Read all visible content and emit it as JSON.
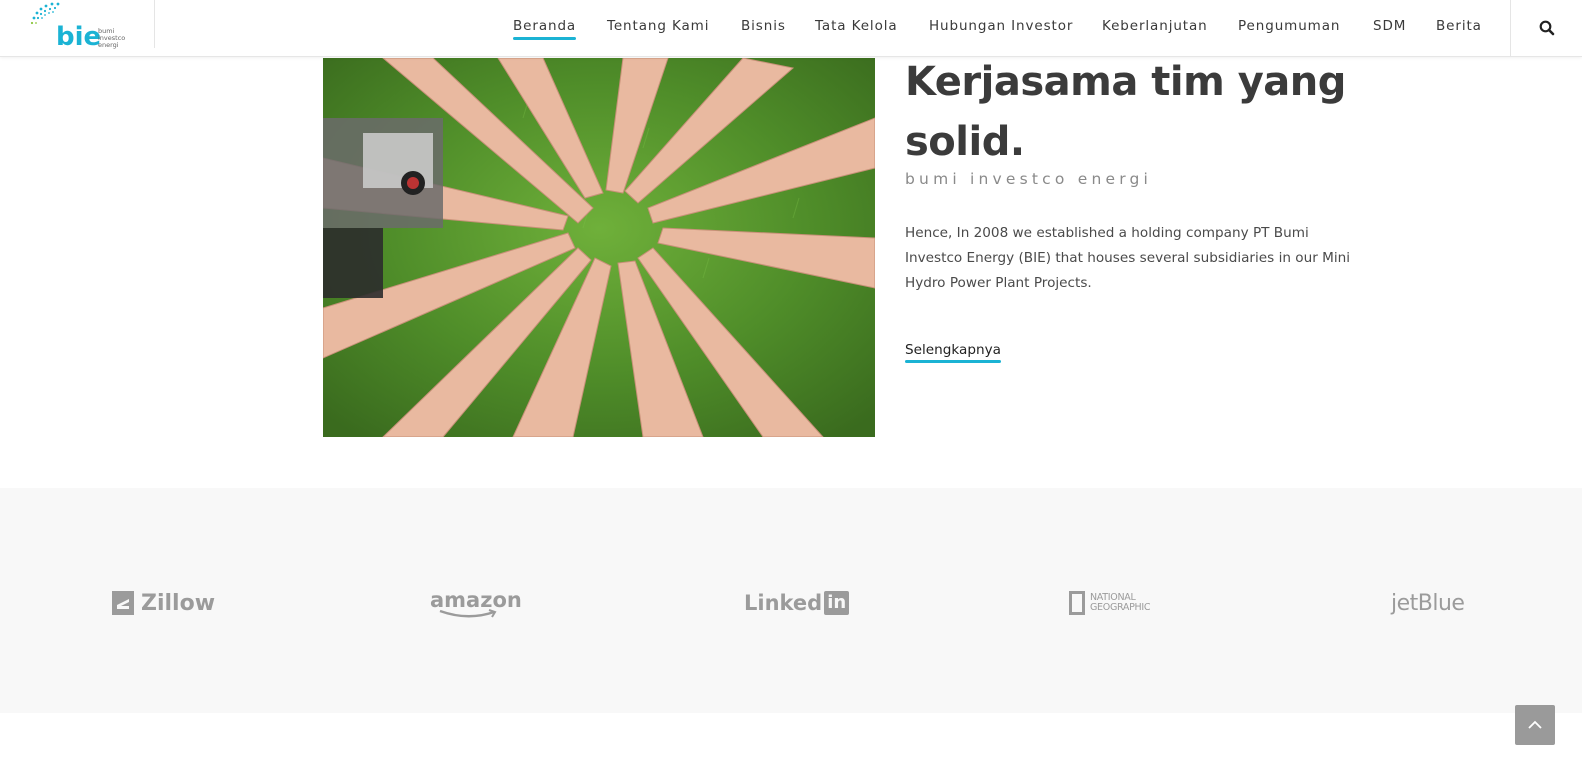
{
  "header": {
    "logo": {
      "mark": "bie",
      "tagline_lines": [
        "bumi",
        "investco",
        "energi"
      ]
    },
    "nav": [
      {
        "label": "Beranda",
        "active": true
      },
      {
        "label": "Tentang Kami",
        "active": false
      },
      {
        "label": "Bisnis",
        "active": false
      },
      {
        "label": "Tata Kelola",
        "active": false
      },
      {
        "label": "Hubungan Investor",
        "active": false
      },
      {
        "label": "Keberlanjutan",
        "active": false
      },
      {
        "label": "Pengumuman",
        "active": false
      },
      {
        "label": "SDM",
        "active": false
      },
      {
        "label": "Berita",
        "active": false
      }
    ],
    "search_icon": "search-icon"
  },
  "hero": {
    "image_icon": "hands-circle-photo",
    "headline": "Kerjasama tim yang solid.",
    "subline": "bumi investco energi",
    "body": "Hence, In 2008 we established a holding company PT Bumi Investco Energy (BIE) that houses several subsidiaries in our Mini Hydro Power Plant Projects.",
    "cta_label": "Selengkapnya"
  },
  "brands": {
    "zillow": "Zillow",
    "amazon": "amazon",
    "linkedin_word": "Linked",
    "linkedin_box": "in",
    "natgeo_line1": "NATIONAL",
    "natgeo_line2": "GEOGRAPHIC",
    "jetblue": "jetBlue"
  },
  "colors": {
    "accent": "#1bb3d4",
    "logo_blue": "#1bb3d4",
    "logo_green": "#8cc63f",
    "brand_gray": "#9b9b9b",
    "band_bg": "#f8f8f8"
  },
  "back_to_top_icon": "chevron-up-icon"
}
